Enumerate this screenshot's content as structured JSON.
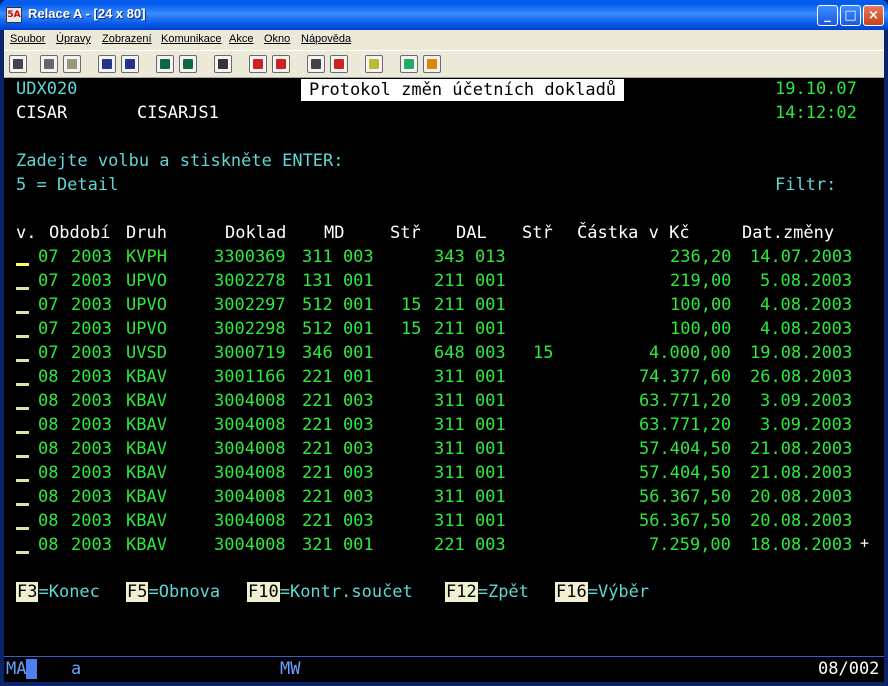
{
  "window": {
    "title": "Relace A - [24 x 80]",
    "icon_label": "5A"
  },
  "menu": [
    "Soubor",
    "Úpravy",
    "Zobrazení",
    "Komunikace",
    "Akce",
    "Okno",
    "Nápověda"
  ],
  "toolbar_icons": [
    "print-icon",
    "copy-icon",
    "paste-icon",
    "send-icon",
    "receive-icon",
    "display-icon",
    "monitor-icon",
    "record-icon",
    "macro-play-icon",
    "macro-stop-icon",
    "keyboard-map-icon",
    "clipboard-icon",
    "globe-icon",
    "pencil-icon"
  ],
  "screen": {
    "program": "UDX020",
    "title": "Protokol změn účetních dokladů",
    "date": "19.10.07",
    "user": "CISAR",
    "job": "CISARJS1",
    "time": "14:12:02",
    "instruction": "Zadejte volbu a stiskněte ENTER:",
    "option": "5 = Detail",
    "filter_label": "Filtr:",
    "columns": {
      "v": "v.",
      "obdobi": "Období",
      "druh": "Druh",
      "doklad": "Doklad",
      "md": "MD",
      "str1": "Stř",
      "dal": "DAL",
      "str2": "Stř",
      "castka": "Částka v Kč",
      "datum": "Dat.změny"
    },
    "rows": [
      {
        "m": "07",
        "y": "2003",
        "druh": "KVPH",
        "doklad": "3300369",
        "md": "311 003",
        "s1": "",
        "dal": "343 013",
        "s2": "",
        "castka": "236,20",
        "datum": "14.07.2003"
      },
      {
        "m": "07",
        "y": "2003",
        "druh": "UPVO",
        "doklad": "3002278",
        "md": "131 001",
        "s1": "",
        "dal": "211 001",
        "s2": "",
        "castka": "219,00",
        "datum": "5.08.2003"
      },
      {
        "m": "07",
        "y": "2003",
        "druh": "UPVO",
        "doklad": "3002297",
        "md": "512 001",
        "s1": "15",
        "dal": "211 001",
        "s2": "",
        "castka": "100,00",
        "datum": "4.08.2003"
      },
      {
        "m": "07",
        "y": "2003",
        "druh": "UPVO",
        "doklad": "3002298",
        "md": "512 001",
        "s1": "15",
        "dal": "211 001",
        "s2": "",
        "castka": "100,00",
        "datum": "4.08.2003"
      },
      {
        "m": "07",
        "y": "2003",
        "druh": "UVSD",
        "doklad": "3000719",
        "md": "346 001",
        "s1": "",
        "dal": "648 003",
        "s2": "15",
        "castka": "4.000,00",
        "datum": "19.08.2003"
      },
      {
        "m": "08",
        "y": "2003",
        "druh": "KBAV",
        "doklad": "3001166",
        "md": "221 001",
        "s1": "",
        "dal": "311 001",
        "s2": "",
        "castka": "74.377,60",
        "datum": "26.08.2003"
      },
      {
        "m": "08",
        "y": "2003",
        "druh": "KBAV",
        "doklad": "3004008",
        "md": "221 003",
        "s1": "",
        "dal": "311 001",
        "s2": "",
        "castka": "63.771,20",
        "datum": "3.09.2003"
      },
      {
        "m": "08",
        "y": "2003",
        "druh": "KBAV",
        "doklad": "3004008",
        "md": "221 003",
        "s1": "",
        "dal": "311 001",
        "s2": "",
        "castka": "63.771,20",
        "datum": "3.09.2003"
      },
      {
        "m": "08",
        "y": "2003",
        "druh": "KBAV",
        "doklad": "3004008",
        "md": "221 003",
        "s1": "",
        "dal": "311 001",
        "s2": "",
        "castka": "57.404,50",
        "datum": "21.08.2003"
      },
      {
        "m": "08",
        "y": "2003",
        "druh": "KBAV",
        "doklad": "3004008",
        "md": "221 003",
        "s1": "",
        "dal": "311 001",
        "s2": "",
        "castka": "57.404,50",
        "datum": "21.08.2003"
      },
      {
        "m": "08",
        "y": "2003",
        "druh": "KBAV",
        "doklad": "3004008",
        "md": "221 003",
        "s1": "",
        "dal": "311 001",
        "s2": "",
        "castka": "56.367,50",
        "datum": "20.08.2003"
      },
      {
        "m": "08",
        "y": "2003",
        "druh": "KBAV",
        "doklad": "3004008",
        "md": "221 003",
        "s1": "",
        "dal": "311 001",
        "s2": "",
        "castka": "56.367,50",
        "datum": "20.08.2003"
      },
      {
        "m": "08",
        "y": "2003",
        "druh": "KBAV",
        "doklad": "3004008",
        "md": "321 001",
        "s1": "",
        "dal": "221 003",
        "s2": "",
        "castka": "7.259,00",
        "datum": "18.08.2003"
      }
    ],
    "more_indicator": "+",
    "fkeys": [
      {
        "key": "F3",
        "label": "=Konec"
      },
      {
        "key": "F5",
        "label": "=Obnova"
      },
      {
        "key": "F10",
        "label": "=Kontr.součet"
      },
      {
        "key": "F12",
        "label": "=Zpět"
      },
      {
        "key": "F16",
        "label": "=Výběr"
      }
    ]
  },
  "status": {
    "session": "MA",
    "session_id": "a",
    "mode": "MW",
    "cursor_pos": "08/002"
  }
}
